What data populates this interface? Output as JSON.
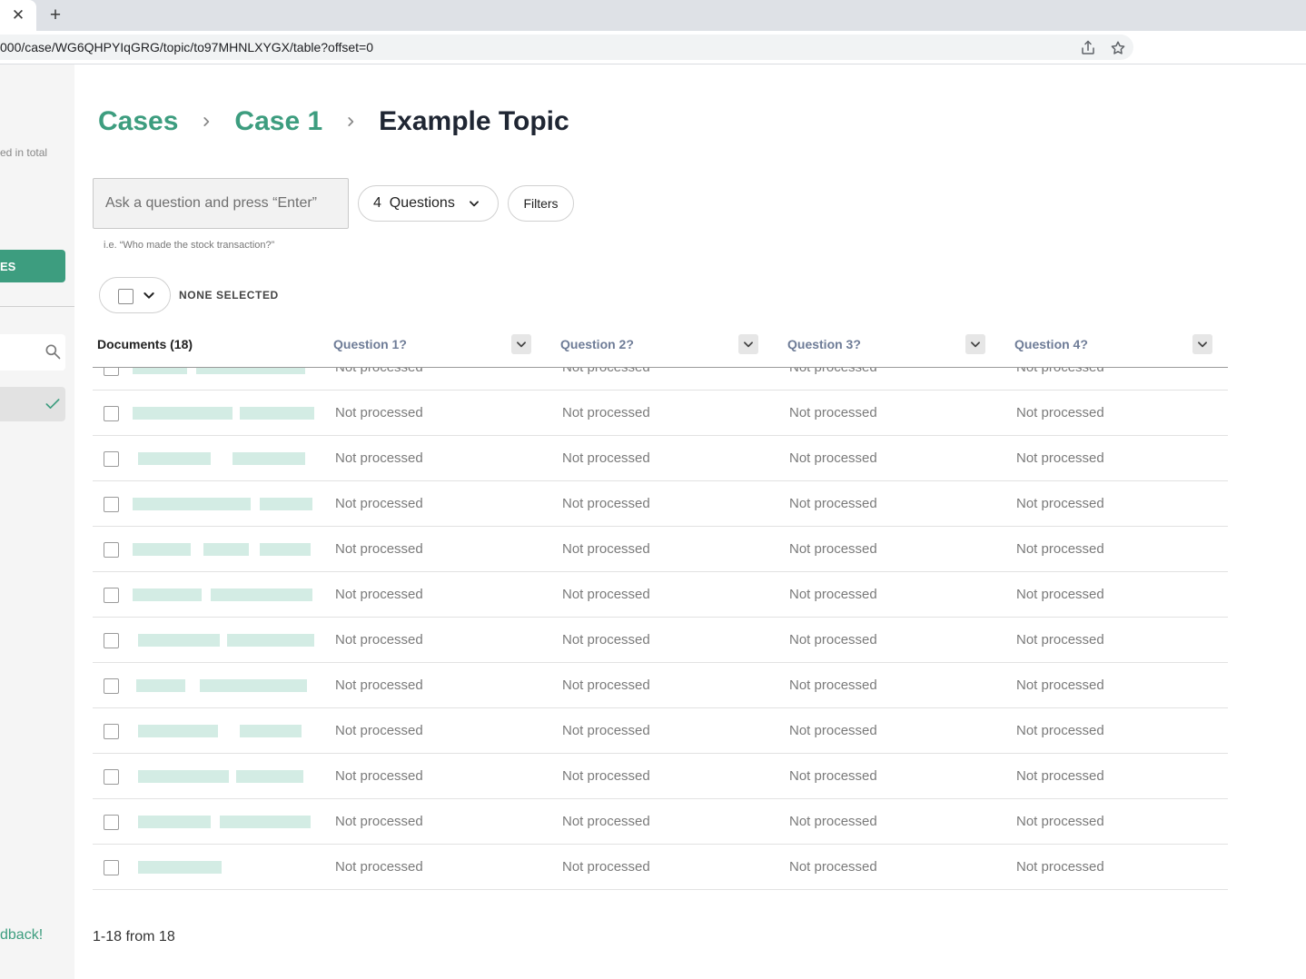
{
  "browser": {
    "url": "000/case/WG6QHPYIqGRG/topic/to97MHNLXYGX/table?offset=0"
  },
  "sidebar": {
    "total_text": "ed in total",
    "button_label": "ES",
    "feedback_text": "dback!"
  },
  "breadcrumb": {
    "cases": "Cases",
    "case": "Case 1",
    "current": "Example Topic"
  },
  "ask": {
    "placeholder": "Ask a question and press “Enter”",
    "hint": "i.e. “Who made the stock transaction?”"
  },
  "questions_button": {
    "label": "4  Questions"
  },
  "filters_button": {
    "label": "Filters"
  },
  "selection": {
    "status": "NONE SELECTED"
  },
  "table": {
    "documents_header": "Documents (18)",
    "question_headers": [
      "Question 1?",
      "Question 2?",
      "Question 3?",
      "Question 4?"
    ],
    "rows": [
      {
        "cells": [
          "Not processed",
          "Not processed",
          "Not processed",
          "Not processed"
        ]
      },
      {
        "cells": [
          "Not processed",
          "Not processed",
          "Not processed",
          "Not processed"
        ]
      },
      {
        "cells": [
          "Not processed",
          "Not processed",
          "Not processed",
          "Not processed"
        ]
      },
      {
        "cells": [
          "Not processed",
          "Not processed",
          "Not processed",
          "Not processed"
        ]
      },
      {
        "cells": [
          "Not processed",
          "Not processed",
          "Not processed",
          "Not processed"
        ]
      },
      {
        "cells": [
          "Not processed",
          "Not processed",
          "Not processed",
          "Not processed"
        ]
      },
      {
        "cells": [
          "Not processed",
          "Not processed",
          "Not processed",
          "Not processed"
        ]
      },
      {
        "cells": [
          "Not processed",
          "Not processed",
          "Not processed",
          "Not processed"
        ]
      },
      {
        "cells": [
          "Not processed",
          "Not processed",
          "Not processed",
          "Not processed"
        ]
      },
      {
        "cells": [
          "Not processed",
          "Not processed",
          "Not processed",
          "Not processed"
        ]
      },
      {
        "cells": [
          "Not processed",
          "Not processed",
          "Not processed",
          "Not processed"
        ]
      },
      {
        "cells": [
          "Not processed",
          "Not processed",
          "Not processed",
          "Not processed"
        ]
      }
    ]
  },
  "pagination": {
    "text": "1-18 from 18"
  },
  "colors": {
    "accent": "#3d9d7f",
    "heading": "#1f2633",
    "muted_header": "#6e7c97",
    "cell_text": "#7a7a7a"
  },
  "icons": {
    "tab_close": "close-icon",
    "new_tab": "plus-icon",
    "share": "share-icon",
    "bookmark": "star-icon",
    "breadcrumb_separator": "chevron-right-icon",
    "dropdown": "chevron-down-icon",
    "search": "search-icon",
    "selected": "check-icon"
  }
}
